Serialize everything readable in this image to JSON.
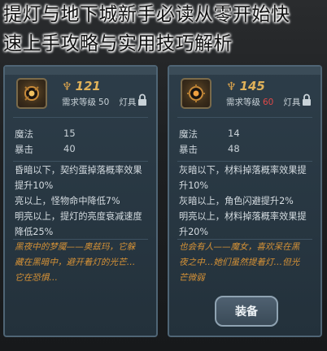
{
  "title": {
    "line1": "提灯与地下城新手必读从零开始快",
    "line2": "速上手攻略与实用技巧解析"
  },
  "cards": [
    {
      "level": "121",
      "req_label": "需求等级",
      "req_value": "50",
      "lamp_label": "灯具",
      "stats": [
        {
          "label": "魔法",
          "value": "15"
        },
        {
          "label": "暴击",
          "value": "40"
        }
      ],
      "effect_lines": [
        "昏暗以下，契约蛋掉落概率效果",
        "提升10%",
        "亮以上，怪物命中降低7%",
        "明亮以上，提灯的亮度衰减速度",
        "降低25%"
      ],
      "flavor_lines": [
        "黑夜中的梦魇——奥兹玛，它躲",
        "藏在黑暗中，避开着灯的光芒…",
        "它在恐惧…"
      ]
    },
    {
      "level": "145",
      "req_label": "需求等级",
      "req_value": "60",
      "lamp_label": "灯具",
      "stats": [
        {
          "label": "魔法",
          "value": "14"
        },
        {
          "label": "暴击",
          "value": "48"
        }
      ],
      "effect_lines": [
        "灰暗以下，材料掉落概率效果提",
        "升10%",
        "灰暗以上，角色闪避提升2%",
        "明亮以上，材料掉落概率效果提",
        "升20%"
      ],
      "flavor_lines": [
        "也会有人——魔女，喜欢呆在黑",
        "夜之中…她们虽然提着灯…但光",
        "芒微弱"
      ],
      "equip_label": "装备"
    }
  ],
  "colors": {
    "level": "#e0b25a",
    "req_warning": "#e04848",
    "flavor": "#d69236"
  }
}
